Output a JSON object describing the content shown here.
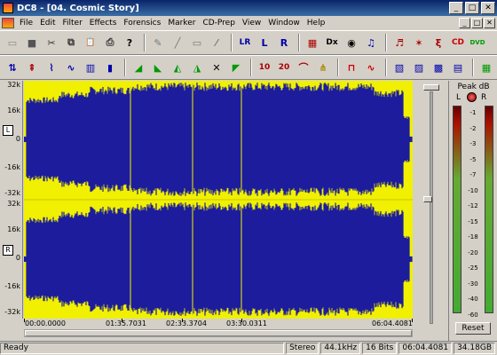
{
  "window": {
    "title": "DC8 - [04. Cosmic Story]",
    "min": "_",
    "max": "□",
    "close": "✕"
  },
  "menu": [
    "File",
    "Edit",
    "Filter",
    "Effects",
    "Forensics",
    "Marker",
    "CD-Prep",
    "View",
    "Window",
    "Help"
  ],
  "toolbar1": [
    {
      "name": "new-file-icon",
      "glyph": "▭",
      "color": "#888"
    },
    {
      "name": "save-icon",
      "glyph": "■",
      "color": "#555"
    },
    {
      "name": "cut-icon",
      "glyph": "✂",
      "color": "#333"
    },
    {
      "name": "copy-icon",
      "glyph": "⧉",
      "color": "#333"
    },
    {
      "name": "paste-icon",
      "glyph": "📋",
      "color": "#333"
    },
    {
      "name": "print-icon",
      "glyph": "⎙",
      "color": "#333"
    },
    {
      "name": "help-icon",
      "glyph": "?",
      "color": "#000"
    },
    {
      "sep": true
    },
    {
      "name": "pencil-icon",
      "glyph": "✎",
      "color": "#777"
    },
    {
      "name": "draw-icon",
      "glyph": "╱",
      "color": "#777"
    },
    {
      "name": "zoom-box-icon",
      "glyph": "▭",
      "color": "#777"
    },
    {
      "name": "brush-icon",
      "glyph": "⁄",
      "color": "#777"
    },
    {
      "sep": true
    },
    {
      "name": "lr-channel-icon",
      "glyph": "LR",
      "color": "#00a"
    },
    {
      "name": "left-channel-icon",
      "glyph": "L",
      "color": "#00a"
    },
    {
      "name": "right-channel-icon",
      "glyph": "R",
      "color": "#00a"
    },
    {
      "sep": true
    },
    {
      "name": "spectrum-icon",
      "glyph": "▦",
      "color": "#a00"
    },
    {
      "name": "dx-plugin-icon",
      "glyph": "Dx",
      "color": "#000"
    },
    {
      "name": "cd-burn-icon",
      "glyph": "◉",
      "color": "#000"
    },
    {
      "name": "eq-icon",
      "glyph": "♫",
      "color": "#00a"
    },
    {
      "sep": true
    },
    {
      "name": "tracks-icon",
      "glyph": "♬",
      "color": "#a00"
    },
    {
      "name": "markers-icon",
      "glyph": "✶",
      "color": "#a00"
    },
    {
      "name": "cdtext-icon",
      "glyph": "ξ",
      "color": "#a00"
    },
    {
      "name": "cd-icon",
      "glyph": "CD",
      "color": "#c00"
    },
    {
      "name": "dvd-icon",
      "glyph": "DVD",
      "color": "#090"
    }
  ],
  "toolbar2": [
    {
      "name": "normalize-icon",
      "glyph": "⇅",
      "color": "#00a"
    },
    {
      "name": "declick-icon",
      "glyph": "⇞",
      "color": "#a00"
    },
    {
      "name": "waveform-view-icon",
      "glyph": "⌇",
      "color": "#00a"
    },
    {
      "name": "filter-icon",
      "glyph": "∿",
      "color": "#00a"
    },
    {
      "name": "graph-icon",
      "glyph": "▥",
      "color": "#00a"
    },
    {
      "name": "bars-icon",
      "glyph": "▮",
      "color": "#00a"
    },
    {
      "sep": true
    },
    {
      "name": "fade-in-icon",
      "glyph": "◢",
      "color": "#090"
    },
    {
      "name": "fade-out-icon",
      "glyph": "◣",
      "color": "#090"
    },
    {
      "name": "fade-wave-icon",
      "glyph": "◭",
      "color": "#090"
    },
    {
      "name": "fade-mid-icon",
      "glyph": "◮",
      "color": "#090"
    },
    {
      "name": "crossfade-icon",
      "glyph": "✕",
      "color": "#000"
    },
    {
      "name": "env-icon",
      "glyph": "◤",
      "color": "#090"
    },
    {
      "sep": true
    },
    {
      "name": "ten-icon",
      "glyph": "10",
      "color": "#a00"
    },
    {
      "name": "twenty-icon",
      "glyph": "20",
      "color": "#a00"
    },
    {
      "name": "arc-icon",
      "glyph": "⌒",
      "color": "#a00"
    },
    {
      "name": "nodes-icon",
      "glyph": "⋔",
      "color": "#a80"
    },
    {
      "sep": true
    },
    {
      "name": "square-wave-icon",
      "glyph": "⊓",
      "color": "#c00"
    },
    {
      "name": "sine-icon",
      "glyph": "∿",
      "color": "#c00"
    },
    {
      "sep": true
    },
    {
      "name": "stripes-icon",
      "glyph": "▧",
      "color": "#00a"
    },
    {
      "name": "diag-icon",
      "glyph": "▨",
      "color": "#00a"
    },
    {
      "name": "hatch-icon",
      "glyph": "▩",
      "color": "#00a"
    },
    {
      "name": "cross-hatch-icon",
      "glyph": "▤",
      "color": "#00a"
    },
    {
      "sep": true
    },
    {
      "name": "fx-icon",
      "glyph": "▦",
      "color": "#090"
    }
  ],
  "ruler": {
    "top": [
      "32k",
      "16k",
      "0",
      "-16k",
      "-32k"
    ],
    "bottom": [
      "32k",
      "16k",
      "0",
      "-16k",
      "-32k"
    ],
    "left_label": "L",
    "right_label": "R"
  },
  "timeline": [
    "00:00.0000",
    "01:35.7031",
    "02:33.3704",
    "03:30.0311",
    "06:04.4081"
  ],
  "peak": {
    "title": "Peak dB",
    "l": "L",
    "r": "R",
    "scale": [
      "-1",
      "-2",
      "-3",
      "-5",
      "-7",
      "-10",
      "-12",
      "-15",
      "-18",
      "-20",
      "-25",
      "-30",
      "-40",
      "-60"
    ],
    "reset": "Reset"
  },
  "status": {
    "ready": "Ready",
    "mode": "Stereo",
    "rate": "44.1kHz",
    "bits": "16 Bits",
    "length": "06:04.4081",
    "size": "34.18GB"
  },
  "colors": {
    "waveform": "#1c1c9c",
    "background": "#f0f000"
  }
}
